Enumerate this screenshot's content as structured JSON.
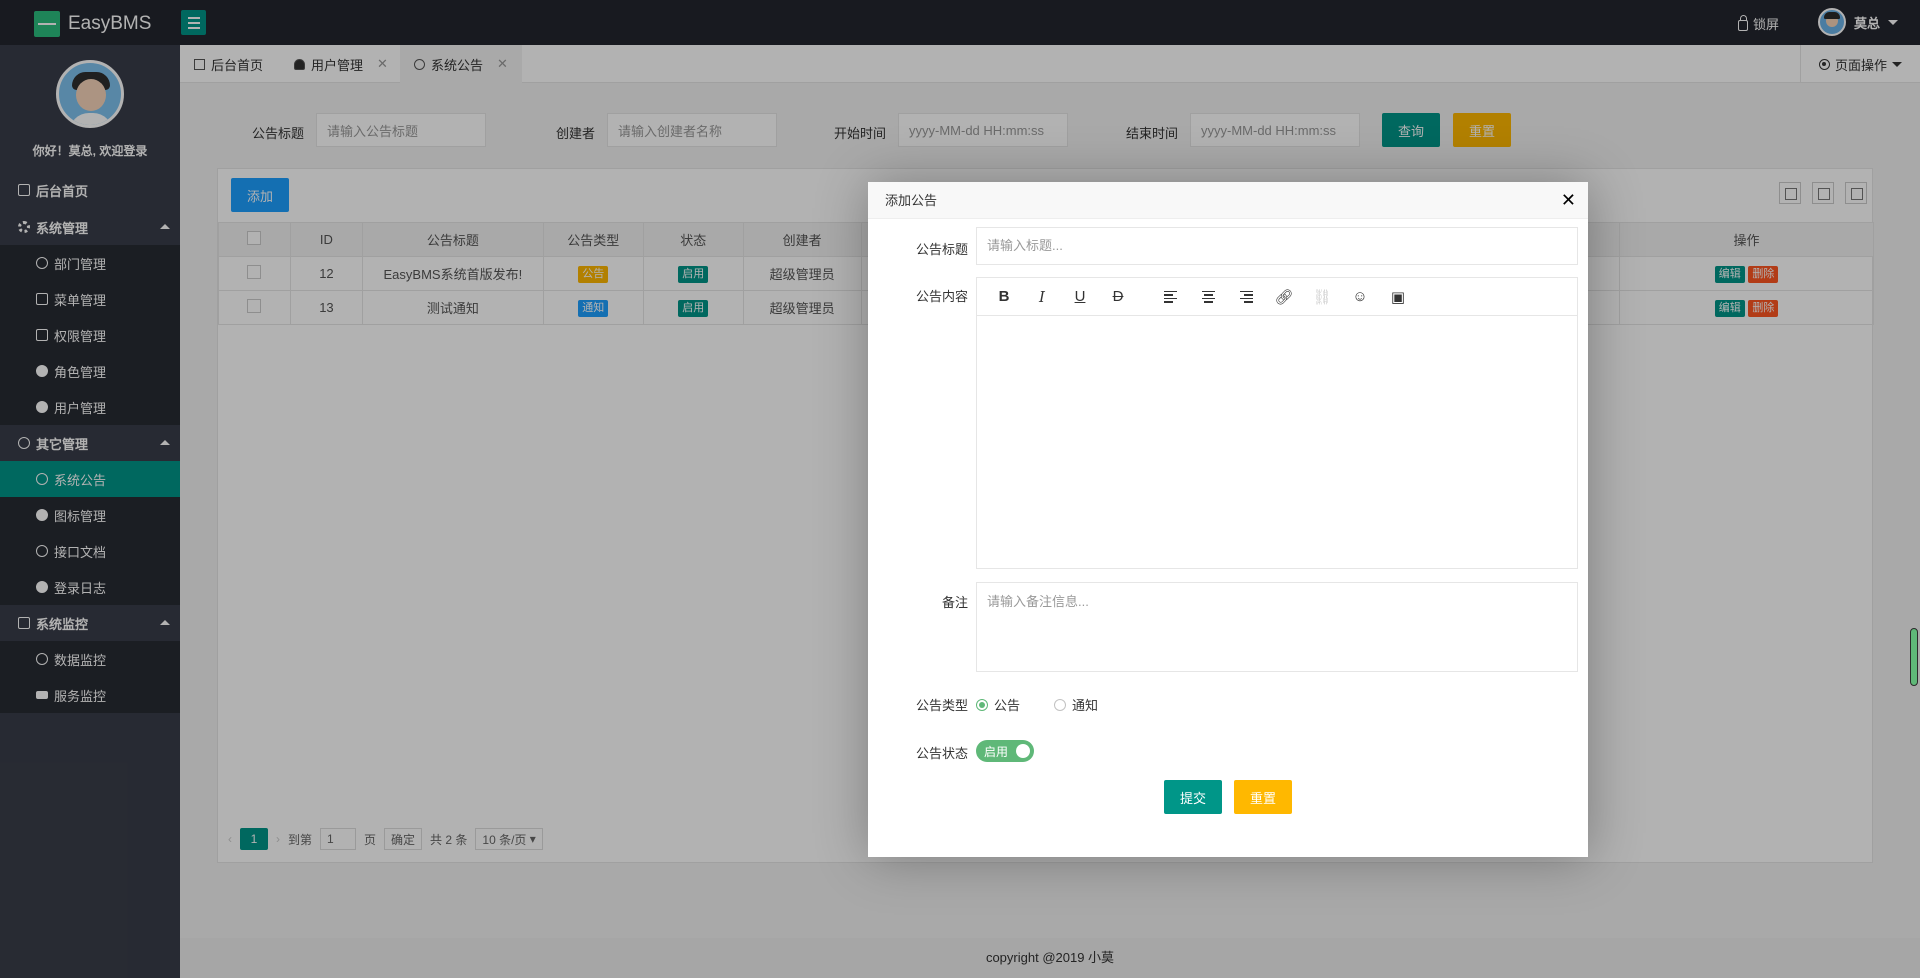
{
  "app": {
    "title": "EasyBMS"
  },
  "header": {
    "lock_label": "锁屏",
    "user_name": "莫总"
  },
  "sidebar": {
    "welcome": "你好！莫总, 欢迎登录",
    "home": "后台首页",
    "groups": [
      {
        "label": "系统管理",
        "items": [
          "部门管理",
          "菜单管理",
          "权限管理",
          "角色管理",
          "用户管理"
        ]
      },
      {
        "label": "其它管理",
        "items": [
          "系统公告",
          "图标管理",
          "接口文档",
          "登录日志"
        ]
      },
      {
        "label": "系统监控",
        "items": [
          "数据监控",
          "服务监控"
        ]
      }
    ]
  },
  "tabs": [
    {
      "label": "后台首页"
    },
    {
      "label": "用户管理"
    },
    {
      "label": "系统公告"
    }
  ],
  "page_ops": "页面操作",
  "search": {
    "title_label": "公告标题",
    "title_placeholder": "请输入公告标题",
    "creator_label": "创建者",
    "creator_placeholder": "请输入创建者名称",
    "start_label": "开始时间",
    "start_placeholder": "yyyy-MM-dd HH:mm:ss",
    "end_label": "结束时间",
    "end_placeholder": "yyyy-MM-dd HH:mm:ss",
    "query_button": "查询",
    "reset_button": "重置"
  },
  "table": {
    "add_button": "添加",
    "columns": [
      "ID",
      "公告标题",
      "公告类型",
      "状态",
      "创建者",
      "操作"
    ],
    "rows": [
      {
        "id": "12",
        "title": "EasyBMS系统首版发布!",
        "type": "公告",
        "status": "启用",
        "creator": "超级管理员"
      },
      {
        "id": "13",
        "title": "测试通知",
        "type": "通知",
        "status": "启用",
        "creator": "超级管理员"
      }
    ],
    "edit_label": "编辑",
    "delete_label": "删除"
  },
  "pager": {
    "current": "1",
    "goto_label": "到第",
    "page_value": "1",
    "page_unit": "页",
    "confirm": "确定",
    "total": "共 2 条",
    "size": "10 条/页"
  },
  "footer": "copyright @2019 小莫",
  "modal": {
    "title": "添加公告",
    "title_label": "公告标题",
    "title_placeholder": "请输入标题...",
    "content_label": "公告内容",
    "remark_label": "备注",
    "remark_placeholder": "请输入备注信息...",
    "type_label": "公告类型",
    "type_options": [
      "公告",
      "通知"
    ],
    "status_label": "公告状态",
    "status_value": "启用",
    "submit_button": "提交",
    "reset_button": "重置"
  },
  "colors": {
    "accent": "#009688",
    "warning": "#ffb800",
    "primary": "#1e9fff",
    "danger": "#ff5722",
    "sidebar": "#393d49",
    "topbar": "#23262e"
  }
}
